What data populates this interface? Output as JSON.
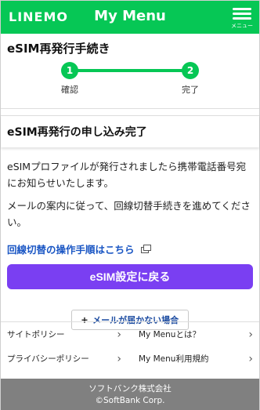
{
  "header": {
    "logo": "LINEMO",
    "title": "My Menu",
    "menu_label": "メニュー"
  },
  "page": {
    "title": "eSIM再発行手続き"
  },
  "stepper": {
    "steps": [
      {
        "number": "1",
        "label": "確認"
      },
      {
        "number": "2",
        "label": "完了"
      }
    ]
  },
  "section": {
    "title": "eSIM再発行の申し込み完了",
    "paragraph1": "eSIMプロファイルが発行されましたら携帯電話番号宛にお知らせいたします。",
    "paragraph2": "メールの案内に従って、回線切替手続きを進めてください。",
    "link_text": "回線切替の操作手順はこちら",
    "primary_button": "eSIM設定に戻る",
    "secondary_button": "メールが届かない場合"
  },
  "footer": {
    "links": [
      {
        "label": "サイトポリシー"
      },
      {
        "label": "My Menuとは？"
      },
      {
        "label": "プライバシーポリシー"
      },
      {
        "label": "My Menu利用規約"
      }
    ],
    "company": "ソフトバンク株式会社",
    "copyright": "©SoftBank Corp."
  },
  "colors": {
    "brand_green": "#06c755",
    "primary_purple": "#7a3ff2",
    "link_blue": "#1a56c4",
    "footer_gray": "#808080"
  }
}
